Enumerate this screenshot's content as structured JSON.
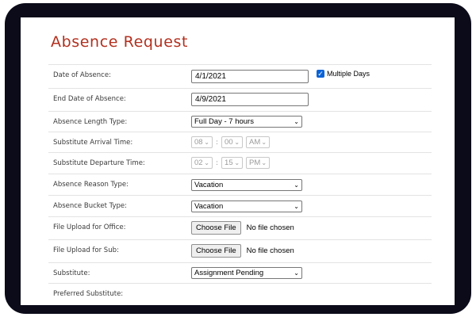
{
  "page": {
    "title": "Absence Request",
    "accent_color": "#b2301f"
  },
  "form": {
    "date_of_absence": {
      "label": "Date of Absence:",
      "value": "4/1/2021"
    },
    "multiple_days": {
      "label": "Multiple Days",
      "checked": true
    },
    "end_date": {
      "label": "End Date of Absence:",
      "value": "4/9/2021"
    },
    "length_type": {
      "label": "Absence Length Type:",
      "value": "Full Day - 7 hours"
    },
    "arrival_time": {
      "label": "Substitute Arrival Time:",
      "hour": "08",
      "minute": "00",
      "ampm": "AM",
      "sep": ":"
    },
    "departure_time": {
      "label": "Substitute Departure Time:",
      "hour": "02",
      "minute": "15",
      "ampm": "PM",
      "sep": ":"
    },
    "reason_type": {
      "label": "Absence Reason Type:",
      "value": "Vacation"
    },
    "bucket_type": {
      "label": "Absence Bucket Type:",
      "value": "Vacation"
    },
    "upload_office": {
      "label": "File Upload for Office:",
      "button": "Choose File",
      "status": "No file chosen"
    },
    "upload_sub": {
      "label": "File Upload for Sub:",
      "button": "Choose File",
      "status": "No file chosen"
    },
    "substitute": {
      "label": "Substitute:",
      "value": "Assignment Pending"
    },
    "preferred_substitute": {
      "label": "Preferred Substitute:"
    }
  },
  "icons": {
    "dropdown": "chevron-down-icon",
    "check": "checkmark-icon"
  }
}
